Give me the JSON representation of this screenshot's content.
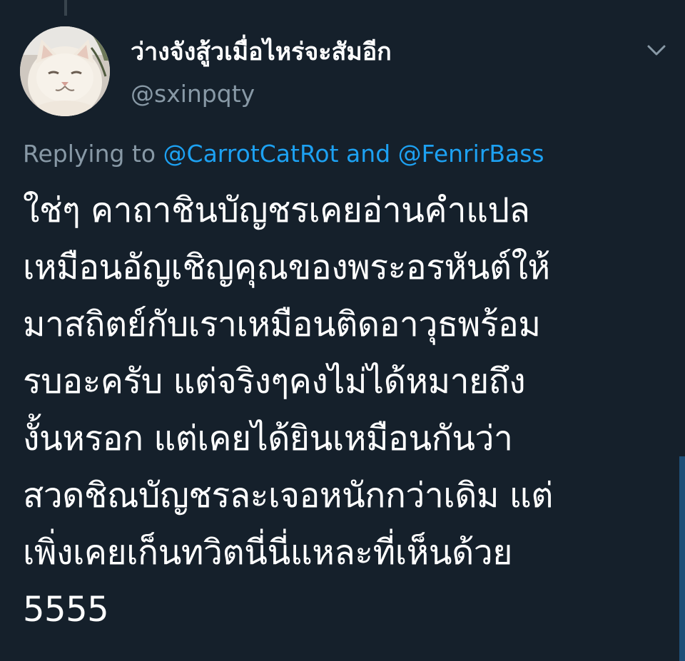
{
  "tweet": {
    "author": {
      "display_name": "ว่างจังสู้วเมื่อไหร่จะสัมอีก",
      "handle": "@sxinpqty",
      "avatar": "cat-avatar"
    },
    "menu_icon": "chevron-down-icon",
    "reply_context": {
      "prefix": "Replying to ",
      "mention_1": "@CarrotCatRot",
      "conjunction": " and ",
      "mention_2": "@FenrirBass"
    },
    "body_lines": [
      "ใช่ๆ คาถาชินบัญชรเคยอ่านคำแปล",
      "เหมือนอัญเชิญคุณของพระอรหันต์ให้",
      "มาสถิตย์กับเราเหมือนติดอาวุธพร้อม",
      "รบอะครับ แต่จริงๆคงไม่ได้หมายถึง",
      "งั้นหรอก แต่เคยได้ยินเหมือนกันว่า",
      "สวดชิณบัญชรละเจอหนักกว่าเดิม แต่",
      "เพิ่งเคยเก็นทวิตนี่นี่แหละที่เห็นด้วย",
      "5555"
    ]
  },
  "colors": {
    "background": "#15202b",
    "text_primary": "#ffffff",
    "text_secondary": "#8899a6",
    "link": "#1da1f2"
  }
}
